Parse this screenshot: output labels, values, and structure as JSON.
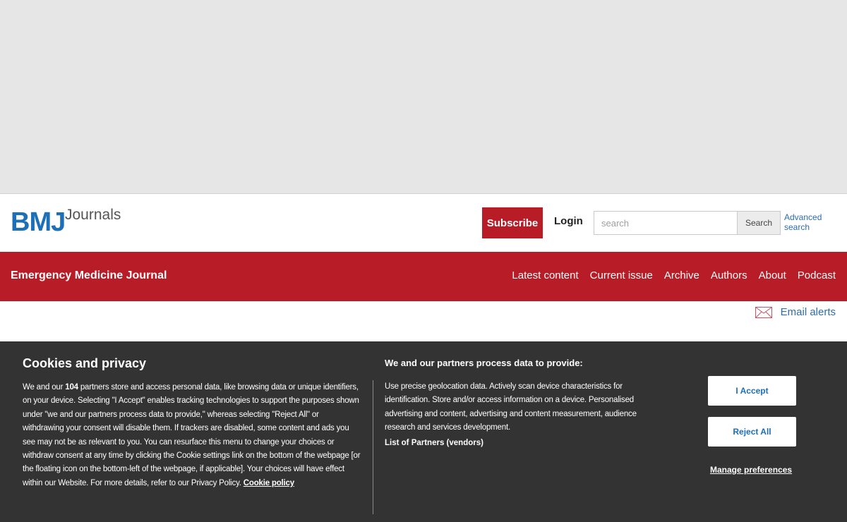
{
  "header": {
    "logo_brand": "BMJ",
    "logo_product": "Journals",
    "subscribe_label": "Subscribe",
    "login_label": "Login",
    "search_placeholder": "search",
    "search_button_label": "Search",
    "advanced_search_label": "Advanced search"
  },
  "navbar": {
    "journal_title": "Emergency Medicine Journal",
    "links": [
      {
        "label": "Latest content"
      },
      {
        "label": "Current issue"
      },
      {
        "label": "Archive"
      },
      {
        "label": "Authors"
      },
      {
        "label": "About"
      },
      {
        "label": "Podcast"
      }
    ]
  },
  "email_alerts": {
    "label": "Email alerts",
    "icon": "envelope-icon"
  },
  "cookie_banner": {
    "title": "Cookies and privacy",
    "body_intro": "We and our ",
    "partner_count": "104",
    "body_rest": " partners store and access personal data, like browsing data or unique identifiers, on your device. Selecting \"I Accept\" enables tracking technologies to support the purposes shown under \"we and our partners process data to provide,\" whereas selecting \"Reject All\" or withdrawing your consent will disable them. If trackers are disabled, some content and ads you see may not be as relevant to you. You can resurface this menu to change your choices or withdraw consent at any time by clicking the Cookie settings link on the bottom of the webpage [or the floating icon on the bottom-left of the webpage, if applicable]. Your choices will have effect within our Website. For more details, refer to our Privacy Policy. ",
    "cookie_policy_link": "Cookie policy",
    "purposes_title": "We and our partners process data to provide:",
    "purposes_text": "Use precise geolocation data. Actively scan device characteristics for identification. Store and/or access information on a device. Personalised advertising and content, advertising and content measurement, audience research and services development.",
    "partners_link": "List of Partners (vendors)",
    "accept_label": "I Accept",
    "reject_label": "Reject All",
    "manage_label": "Manage preferences"
  },
  "colors": {
    "brand_red": "#b71c27",
    "brand_blue": "#1d6fb8",
    "banner_bg": "#333333",
    "ad_bg": "#e5e6e5"
  }
}
